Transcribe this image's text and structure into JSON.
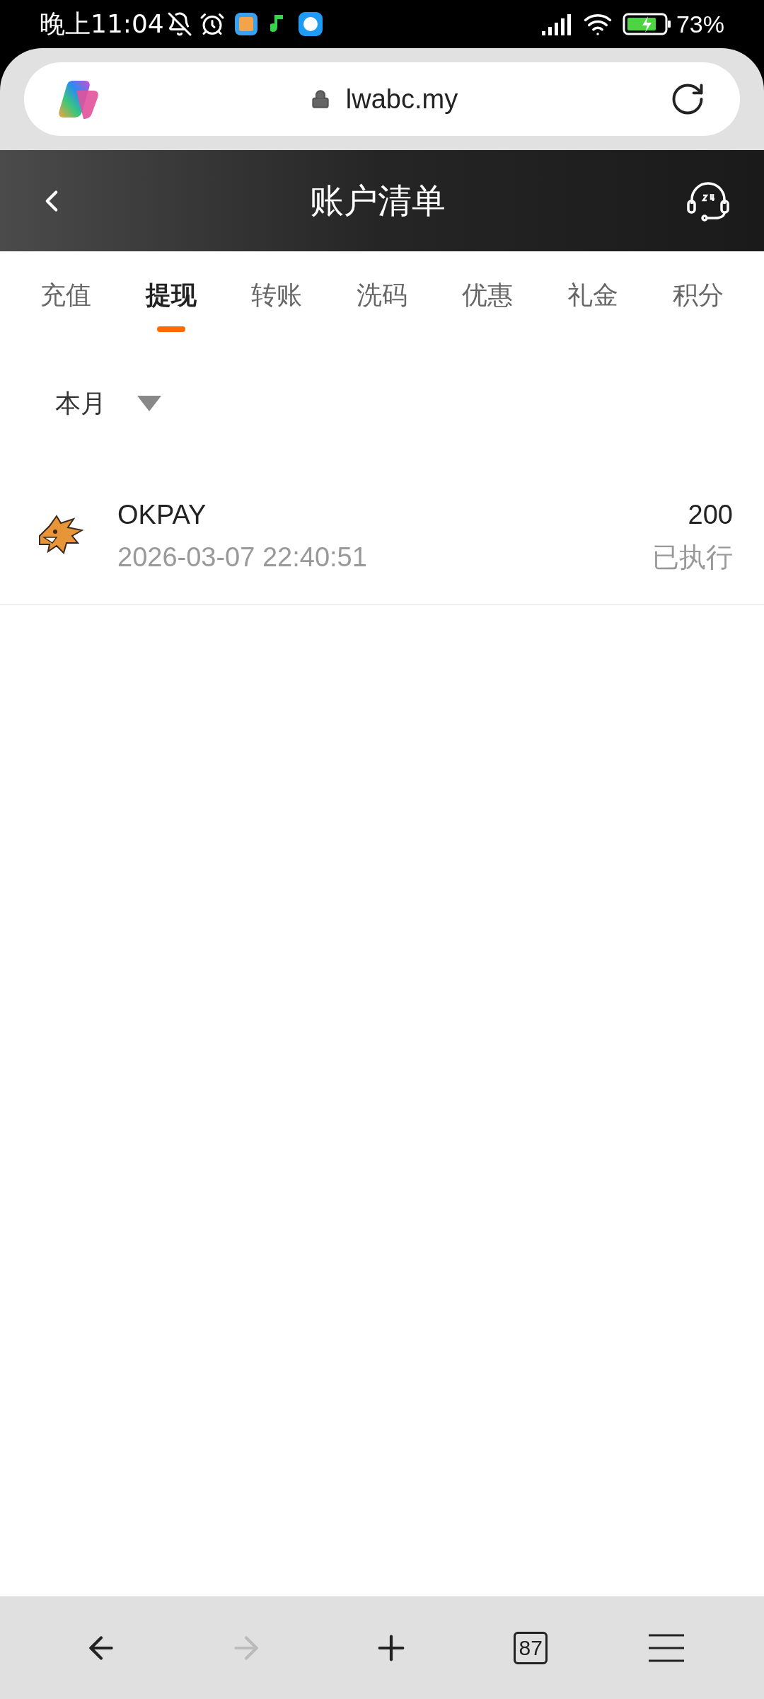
{
  "status_bar": {
    "time": "晚上11:04",
    "battery": "73%"
  },
  "browser": {
    "url": "lwabc.my"
  },
  "header": {
    "title": "账户清单"
  },
  "tabs": [
    {
      "label": "充值",
      "selected": false
    },
    {
      "label": "提现",
      "selected": true
    },
    {
      "label": "转账",
      "selected": false
    },
    {
      "label": "洗码",
      "selected": false
    },
    {
      "label": "优惠",
      "selected": false
    },
    {
      "label": "礼金",
      "selected": false
    },
    {
      "label": "积分",
      "selected": false
    }
  ],
  "filter": {
    "value": "本月"
  },
  "records": [
    {
      "name": "OKPAY",
      "time": "2026-03-07 22:40:51",
      "amount": "200",
      "status": "已执行"
    }
  ],
  "browser_toolbar": {
    "back_disabled": false,
    "forward_disabled": true,
    "tab_count": "87"
  }
}
